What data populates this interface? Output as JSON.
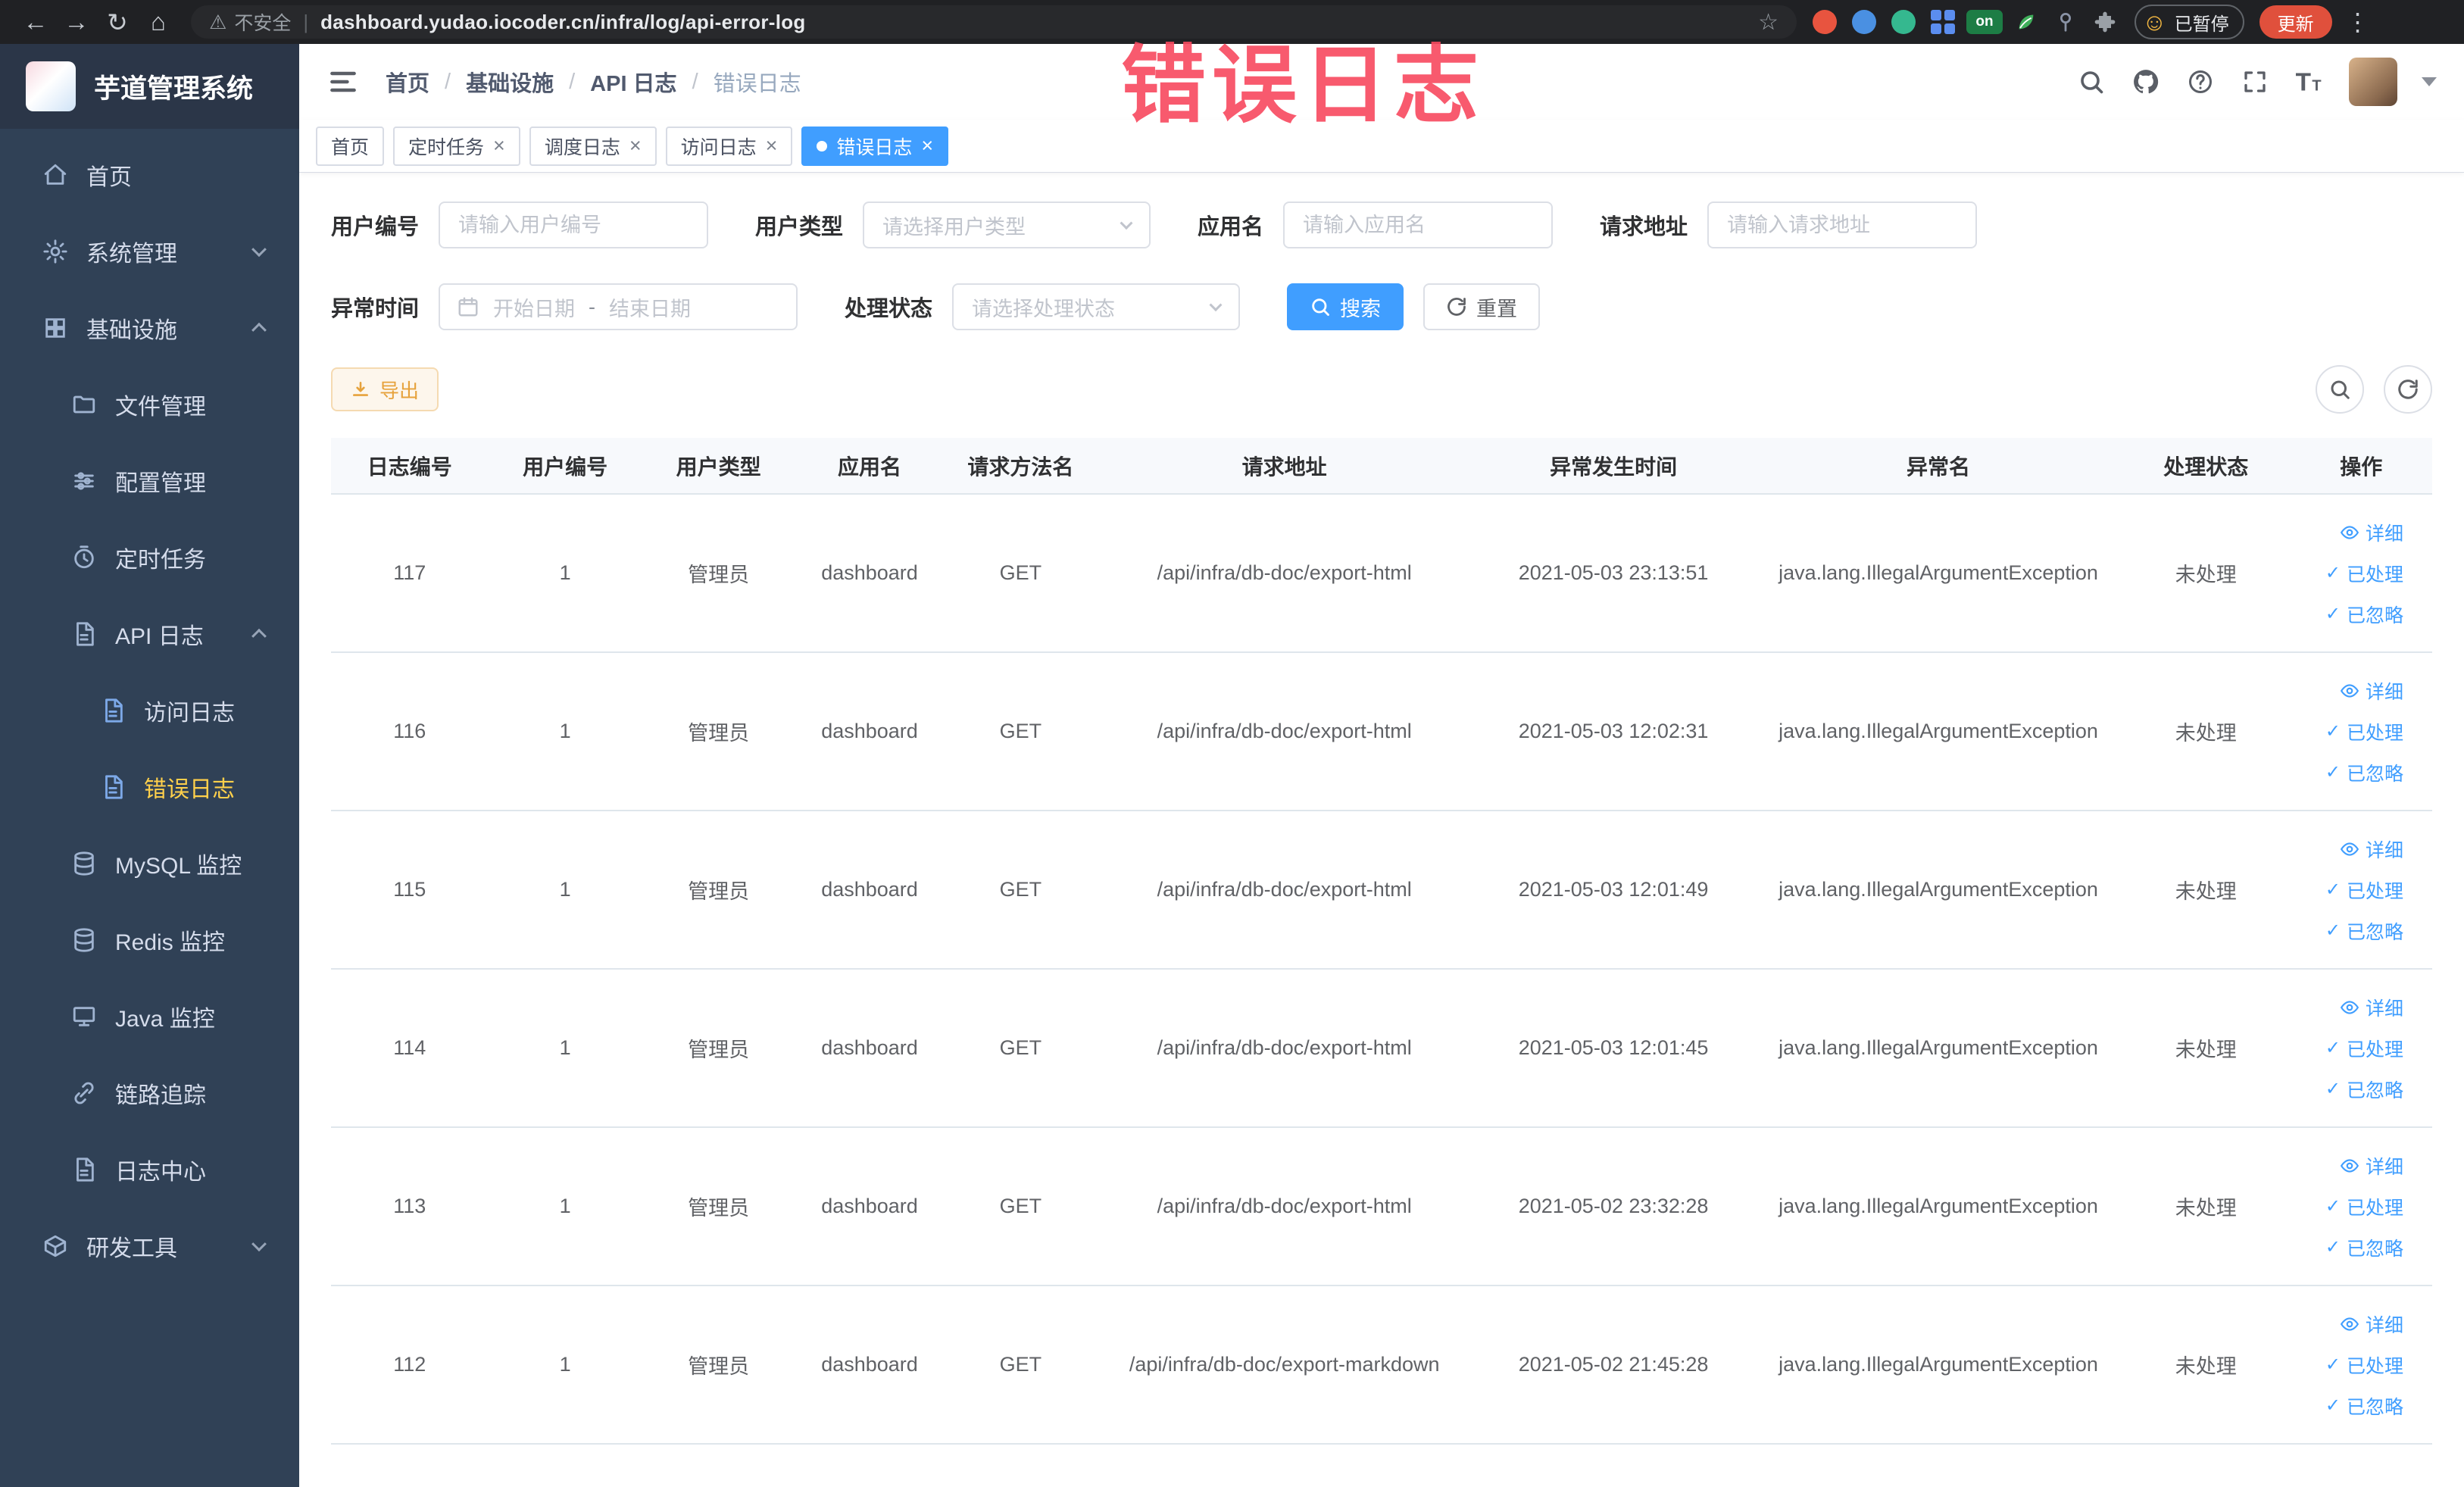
{
  "browser": {
    "security_label": "不安全",
    "url": "dashboard.yudao.iocoder.cn/infra/log/api-error-log",
    "extension_on_badge": "on",
    "profile_status": "已暂停",
    "update_label": "更新"
  },
  "annotation": {
    "text": "错误日志"
  },
  "icons": {
    "back": "←",
    "forward": "→",
    "reload": "↻",
    "home": "⌂",
    "warning": "⚠",
    "star": "☆",
    "menu_dots": "⋮",
    "close": "×",
    "check": "✓",
    "smiley": "☺",
    "omni_sep": "|"
  },
  "sidebar": {
    "logo_title": "芋道管理系统",
    "items": [
      {
        "label": "首页"
      },
      {
        "label": "系统管理"
      },
      {
        "label": "基础设施"
      },
      {
        "label": "文件管理"
      },
      {
        "label": "配置管理"
      },
      {
        "label": "定时任务"
      },
      {
        "label": "API 日志"
      },
      {
        "label": "访问日志"
      },
      {
        "label": "错误日志"
      },
      {
        "label": "MySQL 监控"
      },
      {
        "label": "Redis 监控"
      },
      {
        "label": "Java 监控"
      },
      {
        "label": "链路追踪"
      },
      {
        "label": "日志中心"
      },
      {
        "label": "研发工具"
      }
    ]
  },
  "navbar": {
    "breadcrumb": [
      "首页",
      "基础设施",
      "API 日志",
      "错误日志"
    ]
  },
  "tabs": [
    {
      "label": "首页"
    },
    {
      "label": "定时任务"
    },
    {
      "label": "调度日志"
    },
    {
      "label": "访问日志"
    },
    {
      "label": "错误日志"
    }
  ],
  "filters": {
    "user_id": {
      "label": "用户编号",
      "placeholder": "请输入用户编号"
    },
    "user_type": {
      "label": "用户类型",
      "placeholder": "请选择用户类型"
    },
    "app_name": {
      "label": "应用名",
      "placeholder": "请输入应用名"
    },
    "request_url": {
      "label": "请求地址",
      "placeholder": "请输入请求地址"
    },
    "exception_time": {
      "label": "异常时间",
      "start_placeholder": "开始日期",
      "separator": "-",
      "end_placeholder": "结束日期"
    },
    "process_status": {
      "label": "处理状态",
      "placeholder": "请选择处理状态"
    },
    "search_label": "搜索",
    "reset_label": "重置"
  },
  "toolbar": {
    "export_label": "导出"
  },
  "table": {
    "columns": [
      "日志编号",
      "用户编号",
      "用户类型",
      "应用名",
      "请求方法名",
      "请求地址",
      "异常发生时间",
      "异常名",
      "处理状态",
      "操作"
    ],
    "actions": {
      "detail": "详细",
      "processed": "已处理",
      "ignored": "已忽略"
    },
    "rows": [
      {
        "id": "117",
        "user_id": "1",
        "user_type": "管理员",
        "app": "dashboard",
        "method": "GET",
        "url": "/api/infra/db-doc/export-html",
        "time": "2021-05-03 23:13:51",
        "exception": "java.lang.IllegalArgumentException",
        "status": "未处理"
      },
      {
        "id": "116",
        "user_id": "1",
        "user_type": "管理员",
        "app": "dashboard",
        "method": "GET",
        "url": "/api/infra/db-doc/export-html",
        "time": "2021-05-03 12:02:31",
        "exception": "java.lang.IllegalArgumentException",
        "status": "未处理"
      },
      {
        "id": "115",
        "user_id": "1",
        "user_type": "管理员",
        "app": "dashboard",
        "method": "GET",
        "url": "/api/infra/db-doc/export-html",
        "time": "2021-05-03 12:01:49",
        "exception": "java.lang.IllegalArgumentException",
        "status": "未处理"
      },
      {
        "id": "114",
        "user_id": "1",
        "user_type": "管理员",
        "app": "dashboard",
        "method": "GET",
        "url": "/api/infra/db-doc/export-html",
        "time": "2021-05-03 12:01:45",
        "exception": "java.lang.IllegalArgumentException",
        "status": "未处理"
      },
      {
        "id": "113",
        "user_id": "1",
        "user_type": "管理员",
        "app": "dashboard",
        "method": "GET",
        "url": "/api/infra/db-doc/export-html",
        "time": "2021-05-02 23:32:28",
        "exception": "java.lang.IllegalArgumentException",
        "status": "未处理"
      },
      {
        "id": "112",
        "user_id": "1",
        "user_type": "管理员",
        "app": "dashboard",
        "method": "GET",
        "url": "/api/infra/db-doc/export-markdown",
        "time": "2021-05-02 21:45:28",
        "exception": "java.lang.IllegalArgumentException",
        "status": "未处理"
      }
    ]
  },
  "colors": {
    "primary": "#409eff",
    "active_menu_text": "#ffd04b",
    "warning_button_text": "#e6a23c",
    "annotation": "#f8495f",
    "sidebar_bg": "#304156"
  }
}
